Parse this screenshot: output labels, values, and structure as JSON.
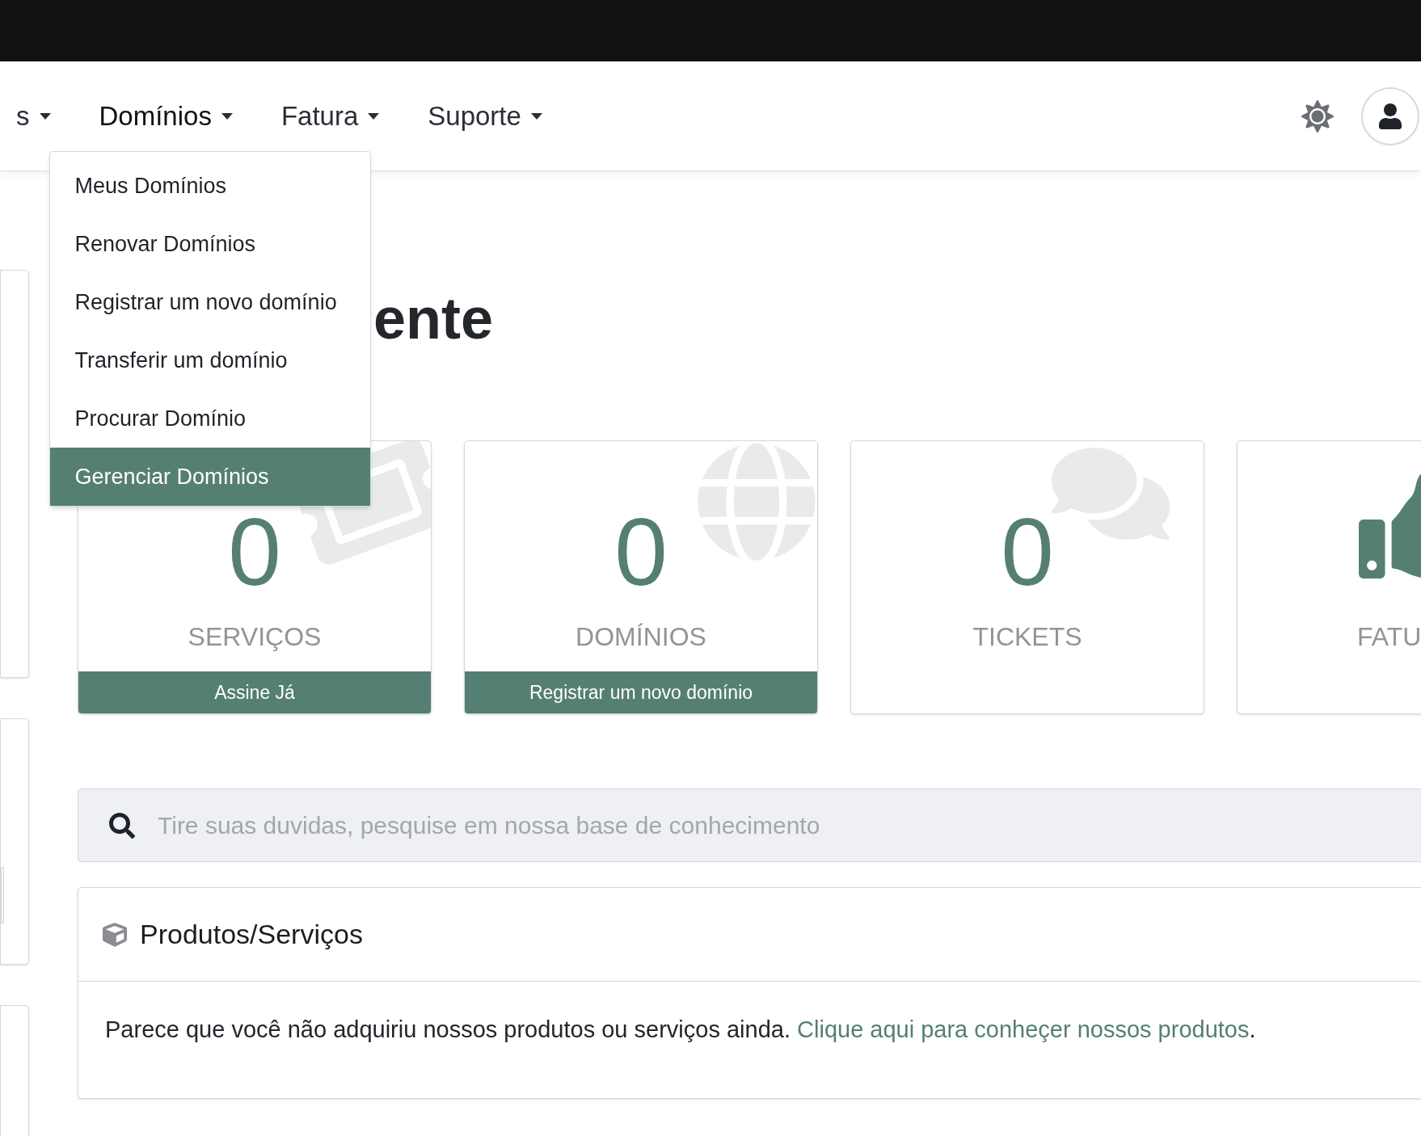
{
  "nav": {
    "items": [
      {
        "label": "s",
        "open": false
      },
      {
        "label": "Domínios",
        "open": true
      },
      {
        "label": "Fatura",
        "open": false
      },
      {
        "label": "Suporte",
        "open": false
      }
    ]
  },
  "dropdown": {
    "items": [
      {
        "label": "Meus Domínios",
        "selected": false
      },
      {
        "label": "Renovar Domínios",
        "selected": false
      },
      {
        "label": "Registrar um novo domínio",
        "selected": false
      },
      {
        "label": "Transferir um domínio",
        "selected": false
      },
      {
        "label": "Procurar Domínio",
        "selected": false
      },
      {
        "label": "Gerenciar Domínios",
        "selected": true
      }
    ]
  },
  "heading": "ente",
  "stats": [
    {
      "kind": "ticket",
      "count": "0",
      "label": "SERVIÇOS",
      "action": "Assine Já"
    },
    {
      "kind": "globe",
      "count": "0",
      "label": "DOMÍNIOS",
      "action": "Registrar um novo domínio"
    },
    {
      "kind": "chat",
      "count": "0",
      "label": "TICKETS"
    },
    {
      "kind": "thumbs",
      "label": "FATU"
    }
  ],
  "search": {
    "placeholder": "Tire suas duvidas, pesquise em nossa base de conhecimento"
  },
  "products": {
    "title": "Produtos/Serviços",
    "message": "Parece que você não adquiriu nossos produtos ou serviços ainda.",
    "link": "Clique aqui para conheçer nossos produtos",
    "after": "."
  }
}
